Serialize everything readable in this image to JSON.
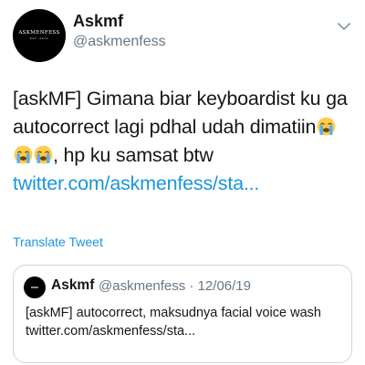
{
  "author": {
    "name": "Askmf",
    "handle": "@askmenfess",
    "avatar_brand": "ASKMENFESS",
    "avatar_tagline": "EST. 2019"
  },
  "tweet": {
    "line1": "[askMF] Gimana biar keyboardist ku ga",
    "line2": "autocorrect lagi pdhal udah dimatiin",
    "line3": ", hp ku samsat btw",
    "link": "twitter.com/askmenfess/sta...",
    "emoji": "loudly-crying-face"
  },
  "translate_label": "Translate Tweet",
  "quoted": {
    "name": "Askmf",
    "handle_date": "@askmenfess · 12/06/19",
    "text": "[askMF] autocorrect, maksudnya facial voice wash",
    "link": "twitter.com/askmenfess/sta..."
  },
  "colors": {
    "link": "#1b95e0",
    "secondary_text": "#657786",
    "border": "#ccd6dd"
  }
}
